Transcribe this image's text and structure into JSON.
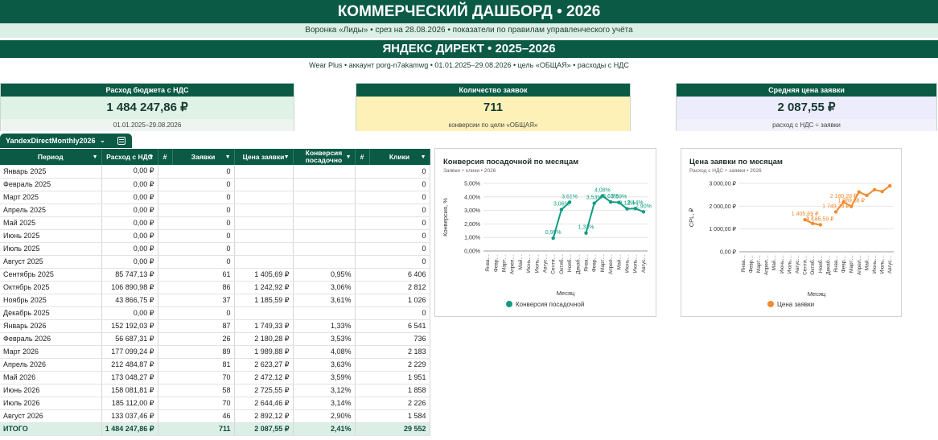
{
  "header": {
    "title": "КОММЕРЧЕСКИЙ ДАШБОРД • 2026",
    "subtitle": "Воронка «Лиды» • срез на 28.08.2026 • показатели по правилам управленческого учёта",
    "section_title": "ЯНДЕКС ДИРЕКТ • 2025–2026",
    "section_subtitle": "Wear Plus • аккаунт porg-n7akamwg • 01.01.2025–29.08.2026 • цель «ОБЩАЯ» • расходы с НДС"
  },
  "kpis": [
    {
      "label": "Расход бюджета с НДС",
      "value": "1 484 247,86 ₽",
      "note": "01.01.2025–29.08.2026"
    },
    {
      "label": "Количество заявок",
      "value": "711",
      "note": "конверсии по цели «ОБЩАЯ»"
    },
    {
      "label": "Средняя цена заявки",
      "value": "2 087,55 ₽",
      "note": "расход с НДС ÷ заявки"
    }
  ],
  "sheet_tab": {
    "name": "YandexDirectMonthly2026",
    "arrow": "⌄"
  },
  "table": {
    "headers": [
      "Период",
      "Расход с НДС",
      "#",
      "Заявки",
      "Цена заявки",
      "Конверсия посадочно",
      "#",
      "Клики"
    ],
    "rows": [
      [
        "Январь 2025",
        "0,00 ₽",
        "0",
        "",
        "",
        "0"
      ],
      [
        "Февраль 2025",
        "0,00 ₽",
        "0",
        "",
        "",
        "0"
      ],
      [
        "Март 2025",
        "0,00 ₽",
        "0",
        "",
        "",
        "0"
      ],
      [
        "Апрель 2025",
        "0,00 ₽",
        "0",
        "",
        "",
        "0"
      ],
      [
        "Май 2025",
        "0,00 ₽",
        "0",
        "",
        "",
        "0"
      ],
      [
        "Июнь 2025",
        "0,00 ₽",
        "0",
        "",
        "",
        "0"
      ],
      [
        "Июль 2025",
        "0,00 ₽",
        "0",
        "",
        "",
        "0"
      ],
      [
        "Август 2025",
        "0,00 ₽",
        "0",
        "",
        "",
        "0"
      ],
      [
        "Сентябрь 2025",
        "85 747,13 ₽",
        "61",
        "1 405,69 ₽",
        "0,95%",
        "6 406"
      ],
      [
        "Октябрь 2025",
        "106 890,98 ₽",
        "86",
        "1 242,92 ₽",
        "3,06%",
        "2 812"
      ],
      [
        "Ноябрь 2025",
        "43 866,75 ₽",
        "37",
        "1 185,59 ₽",
        "3,61%",
        "1 026"
      ],
      [
        "Декабрь 2025",
        "0,00 ₽",
        "0",
        "",
        "",
        "0"
      ],
      [
        "Январь 2026",
        "152 192,03 ₽",
        "87",
        "1 749,33 ₽",
        "1,33%",
        "6 541"
      ],
      [
        "Февраль 2026",
        "56 687,31 ₽",
        "26",
        "2 180,28 ₽",
        "3,53%",
        "736"
      ],
      [
        "Март 2026",
        "177 099,24 ₽",
        "89",
        "1 989,88 ₽",
        "4,08%",
        "2 183"
      ],
      [
        "Апрель 2026",
        "212 484,87 ₽",
        "81",
        "2 623,27 ₽",
        "3,63%",
        "2 229"
      ],
      [
        "Май 2026",
        "173 048,27 ₽",
        "70",
        "2 472,12 ₽",
        "3,59%",
        "1 951"
      ],
      [
        "Июнь 2026",
        "158 081,81 ₽",
        "58",
        "2 725,55 ₽",
        "3,12%",
        "1 858"
      ],
      [
        "Июль 2026",
        "185 112,00 ₽",
        "70",
        "2 644,46 ₽",
        "3,14%",
        "2 226"
      ],
      [
        "Август 2026",
        "133 037,46 ₽",
        "46",
        "2 892,12 ₽",
        "2,90%",
        "1 584"
      ]
    ],
    "total": [
      "ИТОГО",
      "1 484 247,86 ₽",
      "711",
      "2 087,55 ₽",
      "2,41%",
      "29 552"
    ]
  },
  "chart_data": [
    {
      "type": "line",
      "title": "Конверсия посадочной по месяцам",
      "subtitle": "Заявки ÷ клики • 2026",
      "xlabel": "Месяц",
      "ylabel": "Конверсия, %",
      "ylim": [
        0,
        5
      ],
      "yticks": [
        "0,00%",
        "1,00%",
        "2,00%",
        "3,00%",
        "4,00%",
        "5,00%"
      ],
      "categories": [
        "Янва…",
        "Февр…",
        "Март…",
        "Апрел…",
        "Май…",
        "Июнь…",
        "Июль…",
        "Авгус…",
        "Сентя…",
        "Октяб…",
        "Нояб…",
        "Декаб…",
        "Янва…",
        "Февр…",
        "Март…",
        "Апрел…",
        "Май…",
        "Июнь…",
        "Июль…",
        "Авгус…"
      ],
      "series": [
        {
          "name": "Конверсия посадочной",
          "color": "#119c82",
          "values": [
            null,
            null,
            null,
            null,
            null,
            null,
            null,
            null,
            0.95,
            3.06,
            3.61,
            null,
            1.33,
            3.53,
            4.08,
            3.63,
            3.59,
            3.12,
            3.14,
            2.9
          ],
          "labels": [
            "",
            "",
            "",
            "",
            "",
            "",
            "",
            "",
            "0,95%",
            "3,06%",
            "3,61%",
            "",
            "1,33%",
            "3,53%",
            "4,08%",
            "3,63%",
            "3,59%",
            "3,12%",
            "3,14%",
            "2,90%"
          ]
        }
      ],
      "grid": true,
      "legend": "bottom"
    },
    {
      "type": "line",
      "title": "Цена заявки по месяцам",
      "subtitle": "Расход с НДС ÷ заявки • 2026",
      "xlabel": "Месяц",
      "ylabel": "CPL, ₽",
      "ylim": [
        0,
        3000
      ],
      "yticks": [
        "0,00 ₽",
        "1 000,00 ₽",
        "2 000,00 ₽",
        "3 000,00 ₽"
      ],
      "categories": [
        "Янва…",
        "Февр…",
        "Март…",
        "Апрел…",
        "Май…",
        "Июнь…",
        "Июль…",
        "Авгус…",
        "Сентя…",
        "Октяб…",
        "Нояб…",
        "Декаб…",
        "Янва…",
        "Февр…",
        "Март…",
        "Апрел…",
        "Май…",
        "Июнь…",
        "Июль…",
        "Авгус…"
      ],
      "series": [
        {
          "name": "Цена заявки",
          "color": "#f28a2e",
          "values": [
            null,
            null,
            null,
            null,
            null,
            null,
            null,
            null,
            1405.69,
            1242.92,
            1185.59,
            null,
            1749.33,
            2180.28,
            1989.88,
            2623.27,
            2472.12,
            2725.55,
            2644.46,
            2892.12
          ],
          "labels": [
            "",
            "",
            "",
            "",
            "",
            "",
            "",
            "",
            "1 405,69 ₽",
            "1 2…",
            "1 185,59 ₽",
            "",
            "1 749,33 ₽",
            "2 180,28 ₽",
            "1 989,88 ₽",
            "",
            "",
            "",
            "",
            ""
          ]
        }
      ],
      "grid": true,
      "legend": "bottom"
    }
  ]
}
